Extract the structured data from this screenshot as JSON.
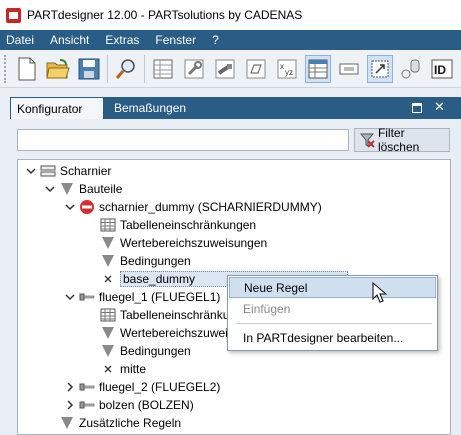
{
  "window": {
    "title": "PARTdesigner 12.00 - PARTsolutions by CADENAS"
  },
  "menu": [
    "Datei",
    "Ansicht",
    "Extras",
    "Fenster",
    "?"
  ],
  "toolbar_icons": [
    "new-document-icon",
    "open-folder-icon",
    "save-disk-icon",
    "magnifier-icon",
    "table-icon",
    "wrench-icon",
    "bolt-icon",
    "shape-icon",
    "xyz-variables-icon",
    "table-view-icon",
    "component-icon",
    "resize-frame-icon",
    "cylinders-icon",
    "id-icon"
  ],
  "panel": {
    "tabs": [
      "Konfigurator",
      "Bemaßungen"
    ],
    "filter_button": "Filter löschen",
    "search_value": ""
  },
  "tree": {
    "nodes": [
      {
        "label": "Scharnier",
        "icon": "assembly-icon",
        "expander": "expanded"
      },
      {
        "label": "Bauteile",
        "icon": "funnel-icon",
        "expander": "expanded"
      },
      {
        "label": "scharnier_dummy (SCHARNIERDUMMY)",
        "icon": "no-entry-icon",
        "expander": "expanded"
      },
      {
        "label": "Tabelleneinschränkungen",
        "icon": "table-icon",
        "expander": "none"
      },
      {
        "label": "Wertebereichszuweisungen",
        "icon": "funnel-icon",
        "expander": "none"
      },
      {
        "label": "Bedingungen",
        "icon": "funnel-icon",
        "expander": "none"
      },
      {
        "label": "base_dummy",
        "icon": "cross-icon",
        "expander": "none",
        "selected": true
      },
      {
        "label": "fluegel_1 (FLUEGEL1)",
        "icon": "bolt-icon",
        "expander": "expanded"
      },
      {
        "label": "Tabelleneinschränkungen",
        "icon": "table-icon",
        "expander": "none"
      },
      {
        "label": "Wertebereichszuweisungen",
        "icon": "funnel-icon",
        "expander": "none"
      },
      {
        "label": "Bedingungen",
        "icon": "funnel-icon",
        "expander": "none"
      },
      {
        "label": "mitte",
        "icon": "cross-icon",
        "expander": "none"
      },
      {
        "label": "fluegel_2 (FLUEGEL2)",
        "icon": "bolt-icon",
        "expander": "collapsed"
      },
      {
        "label": "bolzen (BOLZEN)",
        "icon": "bolt-icon",
        "expander": "collapsed"
      },
      {
        "label": "Zusätzliche Regeln",
        "icon": "funnel-icon",
        "expander": "none"
      }
    ]
  },
  "context_menu": {
    "items": [
      {
        "label": "Neue Regel",
        "state": "highlighted"
      },
      {
        "label": "Einfügen",
        "state": "disabled"
      },
      {
        "label": "In PARTdesigner bearbeiten...",
        "state": "normal"
      }
    ]
  },
  "colors": {
    "menubar": "#2a5d85",
    "panel": "#e9eef4",
    "selection": "#cfdff0",
    "accent_red": "#c62828"
  }
}
